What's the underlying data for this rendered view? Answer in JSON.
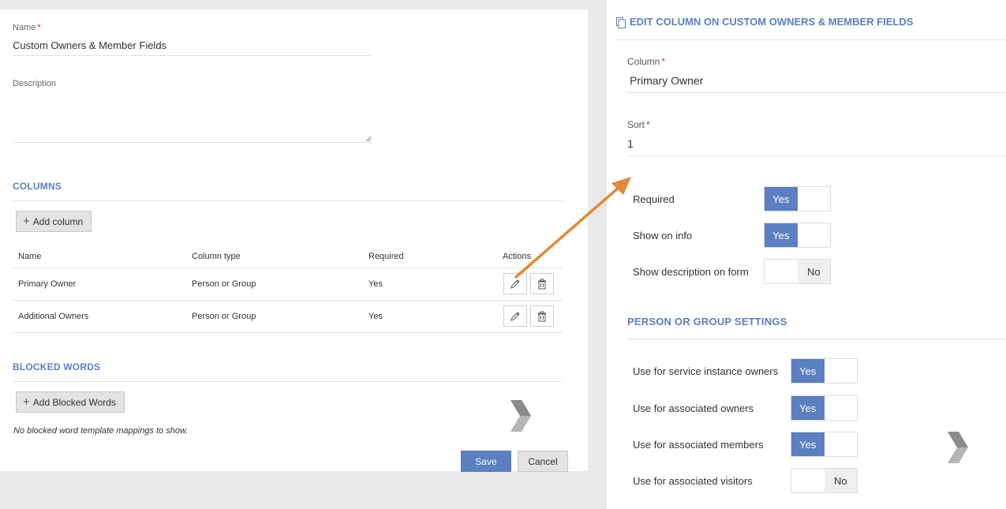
{
  "form": {
    "name_label": "Name",
    "required_mark": "*",
    "name_value": "Custom Owners & Member Fields",
    "description_label": "Description",
    "description_value": "",
    "columns_title": "COLUMNS",
    "add_column_label": "Add column",
    "table_headers": [
      "Name",
      "Column type",
      "Required",
      "Actions"
    ],
    "rows": [
      {
        "name": "Primary Owner",
        "type": "Person or Group",
        "required": "Yes"
      },
      {
        "name": "Additional Owners",
        "type": "Person or Group",
        "required": "Yes"
      }
    ],
    "blocked_words_title": "BLOCKED WORDS",
    "add_blocked_label": "Add Blocked Words",
    "no_blocked_text": "No blocked word template mappings to show.",
    "save_label": "Save",
    "cancel_label": "Cancel"
  },
  "edit_panel": {
    "title": "EDIT COLUMN ON CUSTOM OWNERS & MEMBER FIELDS",
    "column_label": "Column",
    "required_mark": "*",
    "column_value": "Primary Owner",
    "sort_label": "Sort",
    "sort_value": "1",
    "toggles": [
      {
        "label": "Required",
        "on": true,
        "text": "Yes"
      },
      {
        "label": "Show on info",
        "on": true,
        "text": "Yes"
      },
      {
        "label": "Show description on form",
        "on": false,
        "text": "No"
      }
    ],
    "person_group_title": "PERSON OR GROUP SETTINGS",
    "pg_toggles": [
      {
        "label": "Use for service instance owners",
        "on": true,
        "text": "Yes"
      },
      {
        "label": "Use for associated owners",
        "on": true,
        "text": "Yes"
      },
      {
        "label": "Use for associated members",
        "on": true,
        "text": "Yes"
      },
      {
        "label": "Use for associated visitors",
        "on": false,
        "text": "No"
      }
    ]
  },
  "colors": {
    "accent": "#5b7fbf",
    "arrow": "#e08a3c",
    "toggle_off": "#efefef"
  }
}
